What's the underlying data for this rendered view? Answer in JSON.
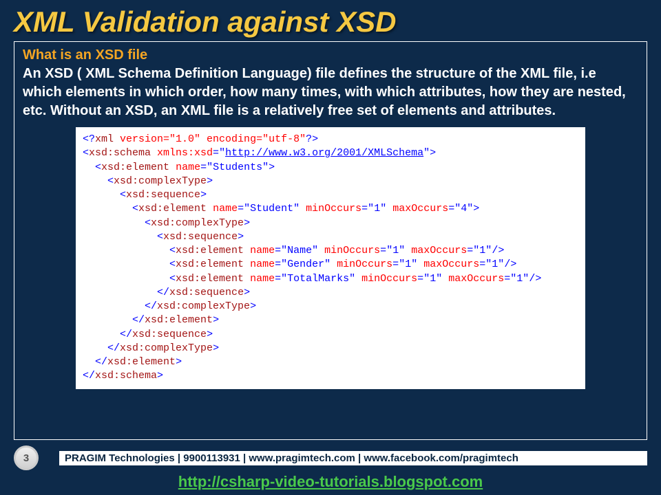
{
  "title": "XML Validation against XSD",
  "subtitle": "What is an XSD file",
  "body": "An XSD ( XML Schema Definition Language) file defines the structure of the XML file, i.e which elements in which order, how many times, with which attributes, how they are nested, etc. Without an XSD, an XML file is a relatively free set of elements and attributes.",
  "code": {
    "xml_decl_open": "<?",
    "xml_decl_name": "xml",
    "xml_decl_attrs": " version=\"1.0\" encoding=\"utf-8\"",
    "xml_decl_close": "?>",
    "schema_open": "<",
    "schema_name": "xsd:schema",
    "xmlns_attr": " xmlns:xsd",
    "xmlns_eq": "=",
    "xmlns_q": "\"",
    "xmlns_url": "http://www.w3.org/2001/XMLSchema",
    "gt": ">",
    "lt": "<",
    "close_lt": "</",
    "slash_gt": "/>",
    "xsd_element": "xsd:element",
    "xsd_complexType": "xsd:complexType",
    "xsd_sequence": "xsd:sequence",
    "name_attr": " name",
    "minOccurs_attr": " minOccurs",
    "maxOccurs_attr": " maxOccurs",
    "eq": "=",
    "q": "\"",
    "students": "Students",
    "student": "Student",
    "name_val": "Name",
    "gender_val": "Gender",
    "totalmarks_val": "TotalMarks",
    "one": "1",
    "four": "4"
  },
  "page_number": "3",
  "footer_text": "PRAGIM Technologies | 9900113931 | www.pragimtech.com | www.facebook.com/pragimtech",
  "bottom_link": "http://csharp-video-tutorials.blogspot.com"
}
